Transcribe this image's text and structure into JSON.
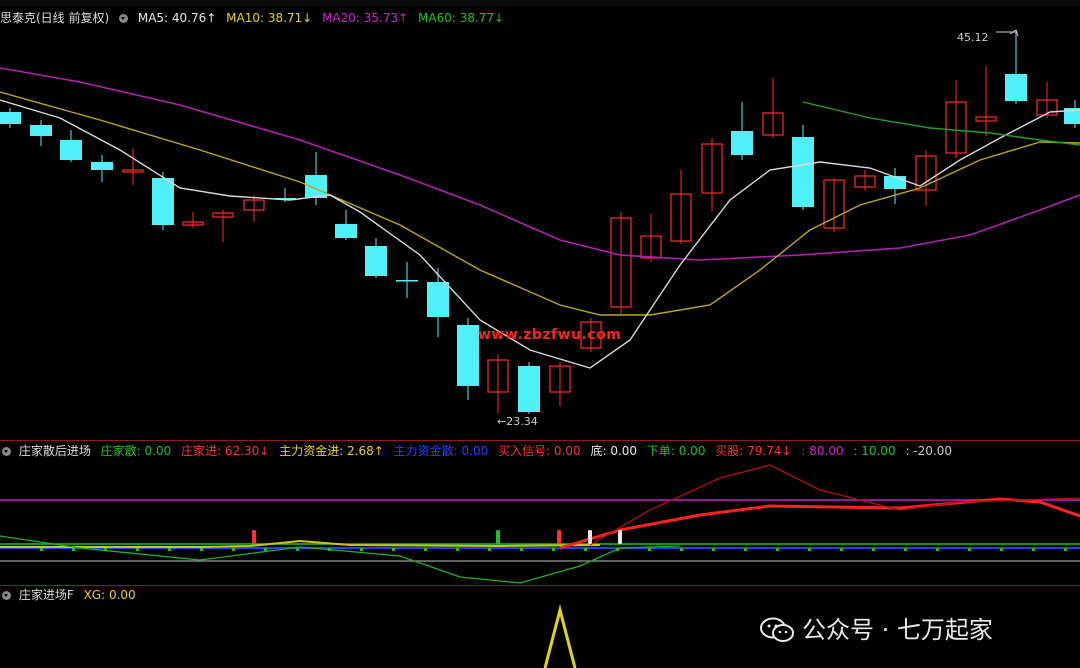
{
  "main": {
    "title": "思泰克(日线 前复权)",
    "ma": [
      {
        "label": "MA5: 40.76↑",
        "color": "#e8e8e8"
      },
      {
        "label": "MA10: 38.71↓",
        "color": "#e6d21a"
      },
      {
        "label": "MA20: 35.73↑",
        "color": "#d020d0"
      },
      {
        "label": "MA60: 38.77↓",
        "color": "#20c020"
      }
    ],
    "high_label": "45.12",
    "low_label": "←23.34",
    "watermark": "www.zbzfwu.com"
  },
  "indicator1": {
    "title": "庄家散后进场",
    "items": [
      {
        "label": "庄家散: 0.00",
        "color": "#20c020"
      },
      {
        "label": "庄家进: 62.30↓",
        "color": "#ff3030"
      },
      {
        "label": "主力资金进: 2.68↑",
        "color": "#e6d21a"
      },
      {
        "label": "主力资金散: 0.00",
        "color": "#2040ff"
      },
      {
        "label": "买入信号: 0.00",
        "color": "#ff3030"
      },
      {
        "label": "底: 0.00",
        "color": "#e8e8e8"
      },
      {
        "label": "下单: 0.00",
        "color": "#20c020"
      },
      {
        "label": "买股: 79.74↓",
        "color": "#ff3030"
      },
      {
        "label": ": 80.00",
        "color": "#d020d0"
      },
      {
        "label": ": 10.00",
        "color": "#20c020"
      },
      {
        "label": ": -20.00",
        "color": "#cccccc"
      }
    ]
  },
  "indicator2": {
    "title": "庄家进场F",
    "items": [
      {
        "label": "XG: 0.00",
        "color": "#e6d21a"
      }
    ]
  },
  "brand": {
    "text": "公众号 · 七万起家"
  },
  "colors": {
    "up": "#ff2a2a",
    "down": "#50f0f8",
    "bg": "#000000"
  }
}
